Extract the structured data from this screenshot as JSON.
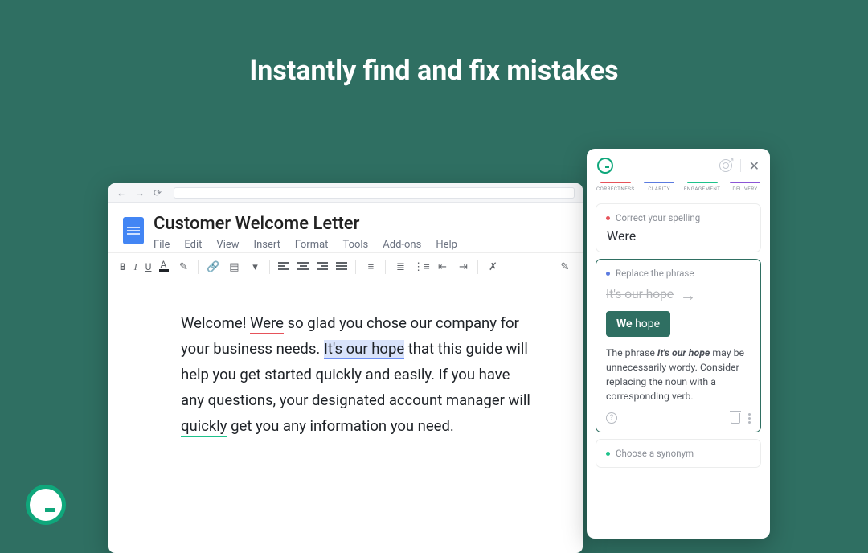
{
  "headline": "Instantly find and fix mistakes",
  "docs": {
    "title": "Customer Welcome Letter",
    "menu": [
      "File",
      "Edit",
      "View",
      "Insert",
      "Format",
      "Tools",
      "Add-ons",
      "Help"
    ],
    "body": {
      "pre1": "Welcome! ",
      "err_red": "Were",
      "post1": " so glad you chose our company for your business needs. ",
      "err_blue": "It's our hope",
      "post2": " that this guide will help you get started quickly and easily. If you have any questions, your designated account manager will ",
      "err_green": "quickly",
      "post3": " get you any information you need."
    }
  },
  "panel": {
    "categories": [
      {
        "label": "CORRECTNESS",
        "color": "#e6525a"
      },
      {
        "label": "CLARITY",
        "color": "#5b7be0"
      },
      {
        "label": "ENGAGEMENT",
        "color": "#1ec28b"
      },
      {
        "label": "DELIVERY",
        "color": "#8c55d6"
      }
    ],
    "card_spelling": {
      "hint": "Correct your spelling",
      "word": "Were",
      "dot": "#e6525a"
    },
    "card_replace": {
      "hint": "Replace the phrase",
      "strike": "It's our hope",
      "pill_bold": "We",
      "pill_rest": " hope",
      "explain_pre": "The phrase ",
      "explain_em": "It's our hope",
      "explain_post": " may be unnecessarily wordy. Consider replacing the noun with a corresponding verb.",
      "dot": "#5b7be0"
    },
    "card_synonym": {
      "hint": "Choose a synonym",
      "dot": "#1ec28b"
    }
  }
}
